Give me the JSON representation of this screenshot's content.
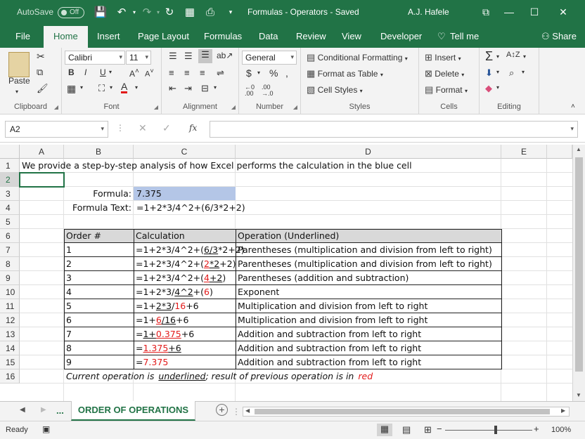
{
  "titlebar": {
    "autosave_label": "AutoSave",
    "autosave_state": "Off",
    "title": "Formulas - Operators  -  Saved",
    "user": "A.J. Hafele"
  },
  "tabs": [
    {
      "label": "File"
    },
    {
      "label": "Home"
    },
    {
      "label": "Insert"
    },
    {
      "label": "Page Layout"
    },
    {
      "label": "Formulas"
    },
    {
      "label": "Data"
    },
    {
      "label": "Review"
    },
    {
      "label": "View"
    },
    {
      "label": "Developer"
    },
    {
      "label": "Tell me"
    }
  ],
  "share_label": "Share",
  "ribbon": {
    "clipboard": {
      "label": "Clipboard",
      "paste": "Paste"
    },
    "font": {
      "label": "Font",
      "name": "Calibri",
      "size": "11"
    },
    "alignment": {
      "label": "Alignment"
    },
    "number": {
      "label": "Number",
      "format": "General"
    },
    "styles": {
      "label": "Styles",
      "conditional": "Conditional Formatting",
      "format_table": "Format as Table",
      "cell_styles": "Cell Styles"
    },
    "cells": {
      "label": "Cells",
      "insert": "Insert",
      "delete": "Delete",
      "format": "Format"
    },
    "editing": {
      "label": "Editing"
    }
  },
  "formula_bar": {
    "name_box": "A2",
    "fx": "fx",
    "value": ""
  },
  "columns": [
    "A",
    "B",
    "C",
    "D",
    "E"
  ],
  "rows": [
    "1",
    "2",
    "3",
    "4",
    "5",
    "6",
    "7",
    "8",
    "9",
    "10",
    "11",
    "12",
    "13",
    "14",
    "15",
    "16"
  ],
  "sheet": {
    "r1": "We provide a step-by-step analysis of how Excel performs the calculation in the blue cell",
    "formula_label": "Formula:",
    "formula_value": "7.375",
    "formula_text_label": "Formula Text:",
    "formula_text": "=1+2*3/4^2+(6/3*2+2)",
    "headers": [
      "Order #",
      "Calculation",
      "Operation (Underlined)"
    ],
    "steps": [
      {
        "order": "1",
        "calc": [
          {
            "t": "=1+2*3/4^2+("
          },
          {
            "t": "6/3",
            "u": true
          },
          {
            "t": "*2+2)"
          }
        ],
        "op": "Parentheses (multiplication and division from left to right)"
      },
      {
        "order": "2",
        "calc": [
          {
            "t": "=1+2*3/4^2+("
          },
          {
            "t": "2",
            "r": true,
            "u": true
          },
          {
            "t": "*2",
            "u": true
          },
          {
            "t": "+2)"
          }
        ],
        "op": "Parentheses (multiplication and division from left to right)"
      },
      {
        "order": "3",
        "calc": [
          {
            "t": "=1+2*3/4^2+("
          },
          {
            "t": "4",
            "r": true,
            "u": true
          },
          {
            "t": "+2",
            "u": true
          },
          {
            "t": ")"
          }
        ],
        "op": "Parentheses (addition and subtraction)"
      },
      {
        "order": "4",
        "calc": [
          {
            "t": "=1+2*3/"
          },
          {
            "t": "4^2",
            "u": true
          },
          {
            "t": "+("
          },
          {
            "t": "6",
            "r": true
          },
          {
            "t": ")"
          }
        ],
        "op": "Exponent"
      },
      {
        "order": "5",
        "calc": [
          {
            "t": "=1+"
          },
          {
            "t": "2*3",
            "u": true
          },
          {
            "t": "/"
          },
          {
            "t": "16",
            "r": true
          },
          {
            "t": "+6"
          }
        ],
        "op": "Multiplication and division from left to right"
      },
      {
        "order": "6",
        "calc": [
          {
            "t": "=1+"
          },
          {
            "t": "6",
            "r": true,
            "u": true
          },
          {
            "t": "/16",
            "u": true
          },
          {
            "t": "+6"
          }
        ],
        "op": "Multiplication and division from left to right"
      },
      {
        "order": "7",
        "calc": [
          {
            "t": "="
          },
          {
            "t": "1+",
            "u": true
          },
          {
            "t": "0.375",
            "r": true,
            "u": true
          },
          {
            "t": "+6"
          }
        ],
        "op": "Addition and subtraction from left to right"
      },
      {
        "order": "8",
        "calc": [
          {
            "t": "="
          },
          {
            "t": "1.375",
            "r": true,
            "u": true
          },
          {
            "t": "+6",
            "u": true
          }
        ],
        "op": "Addition and subtraction from left to right"
      },
      {
        "order": "9",
        "calc": [
          {
            "t": "="
          },
          {
            "t": "7.375",
            "r": true
          }
        ],
        "op": "Addition and subtraction from left to right"
      }
    ],
    "note_prefix": "Current operation is",
    "note_underlined": "underlined",
    "note_middle": "; result of previous operation is in",
    "note_red": "red"
  },
  "sheet_tabs": {
    "ellipsis": "...",
    "active": "ORDER OF OPERATIONS"
  },
  "status": {
    "ready": "Ready",
    "zoom": "100%"
  },
  "colors": {
    "excel_green": "#217346",
    "highlight_blue": "#b4c6e7",
    "red": "#e21a1a"
  }
}
